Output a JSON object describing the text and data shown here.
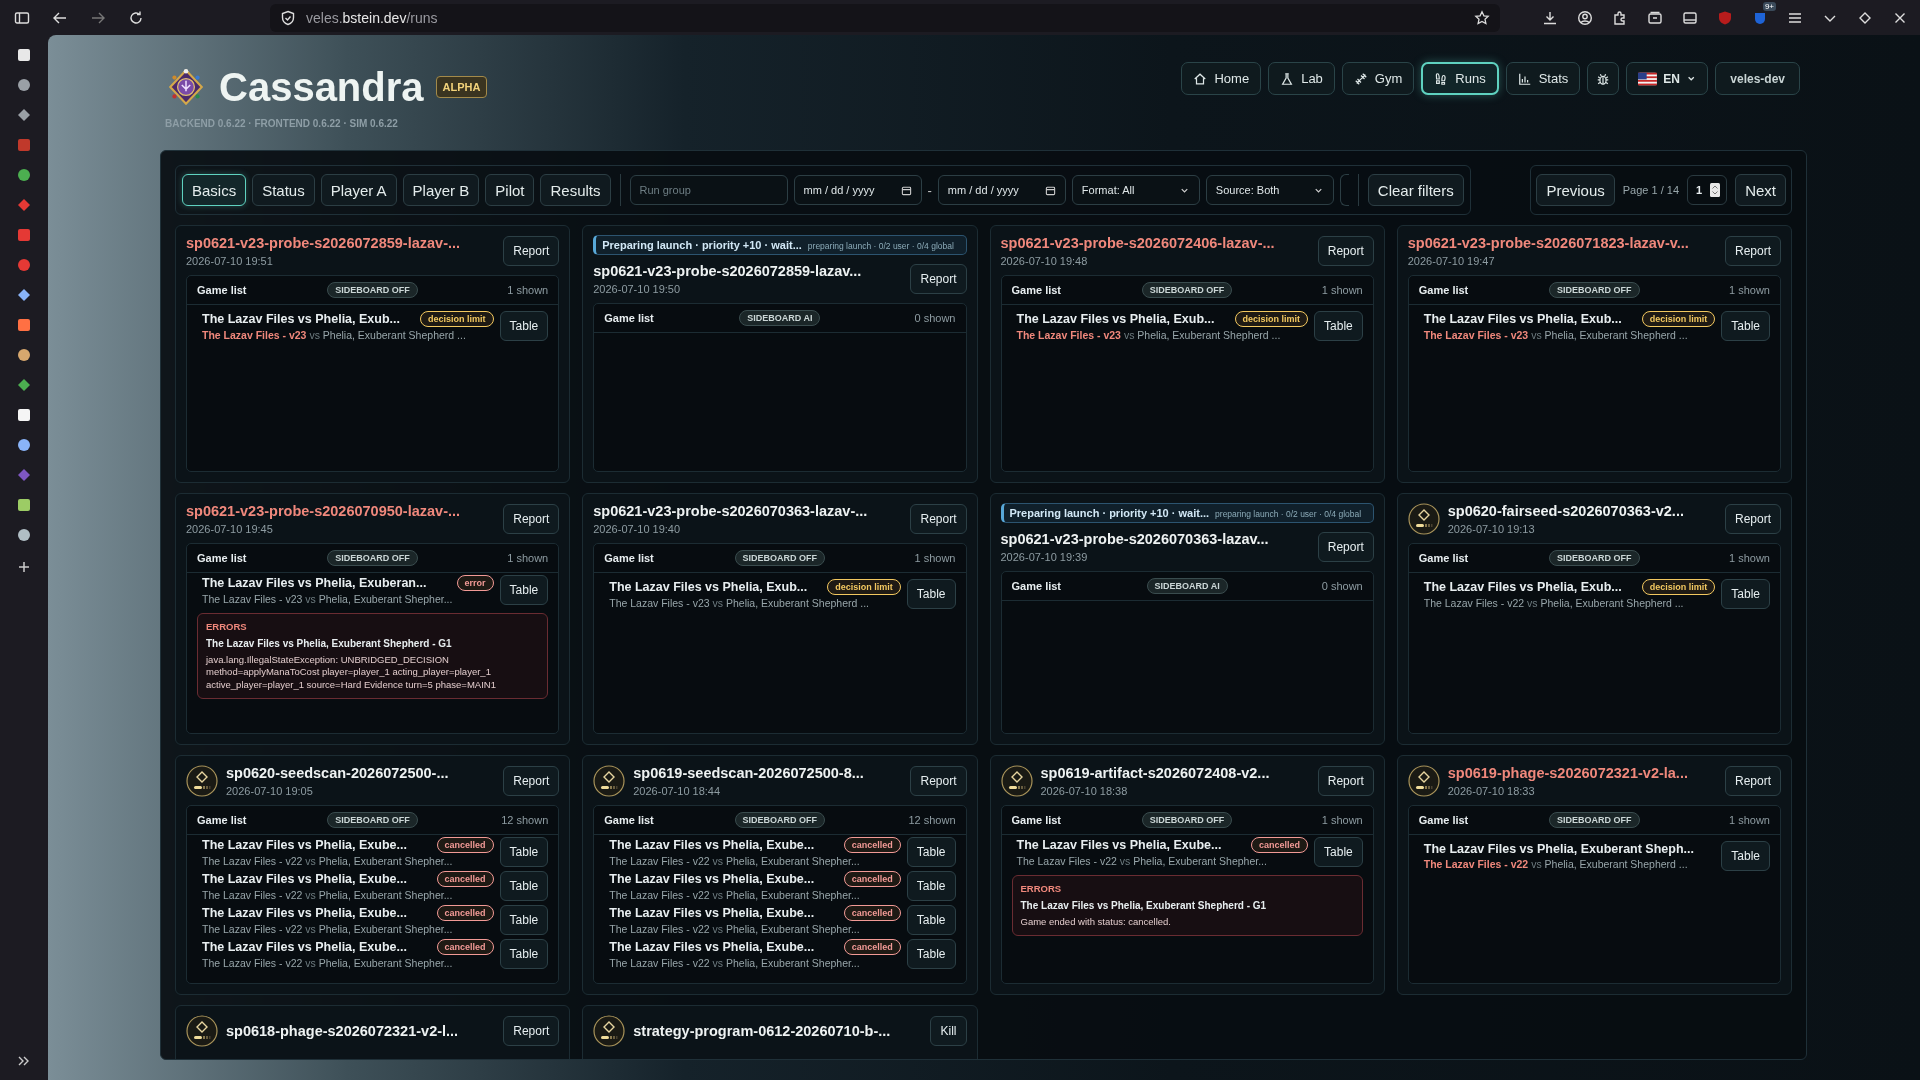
{
  "browser": {
    "url": {
      "subdomain": "veles.",
      "domain": "bstein.dev",
      "path": "/runs"
    },
    "extension_badge": "9+"
  },
  "header": {
    "title": "Cassandra",
    "badge": "ALPHA",
    "versions": "BACKEND 0.6.22 · FRONTEND 0.6.22 · SIM 0.6.22"
  },
  "nav": {
    "items": [
      {
        "label": "Home",
        "selected": false
      },
      {
        "label": "Lab",
        "selected": false
      },
      {
        "label": "Gym",
        "selected": false
      },
      {
        "label": "Runs",
        "selected": true
      },
      {
        "label": "Stats",
        "selected": false
      }
    ],
    "language": "EN",
    "user": "veles-dev"
  },
  "filters": {
    "tabs": [
      {
        "label": "Basics",
        "selected": true
      },
      {
        "label": "Status",
        "selected": false
      },
      {
        "label": "Player A",
        "selected": false
      },
      {
        "label": "Player B",
        "selected": false
      },
      {
        "label": "Pilot",
        "selected": false
      },
      {
        "label": "Results",
        "selected": false
      }
    ],
    "run_group": {
      "placeholder": "Run group"
    },
    "date_from": {
      "placeholder": "mm / dd / yyyy"
    },
    "date_separator": "-",
    "date_to": {
      "placeholder": "mm / dd / yyyy"
    },
    "format": "Format: All",
    "source": "Source: Both",
    "clear": "Clear filters"
  },
  "pagination": {
    "previous": "Previous",
    "page": "Page 1 / 14",
    "page_input": "1",
    "next": "Next"
  },
  "cards": [
    {
      "title": "sp0621-v23-probe-s2026072859-lazav-...",
      "highlight": true,
      "avatar": false,
      "date": "2026-07-10 19:51",
      "action": "Report",
      "list": {
        "label": "Game list",
        "sideboard": "SIDEBOARD OFF",
        "shown": "1 shown",
        "games": [
          {
            "title": "The Lazav Files vs Phelia, Exub...",
            "status": "decision limit",
            "color": "#f2c860",
            "player_a": "The Lazav Files - v23",
            "player_a_highlight": true,
            "versus": "vs",
            "player_b": "Phelia, Exuberant Shepherd ...",
            "action": "Table"
          }
        ]
      }
    },
    {
      "banner": {
        "text": "Preparing launch · priority +10 · wait...",
        "detail": "preparing launch · 0/2 user · 0/4 global"
      },
      "title": "sp0621-v23-probe-s2026072859-lazav...",
      "highlight": false,
      "avatar": false,
      "date": "2026-07-10 19:50",
      "action": "Report",
      "list": {
        "label": "Game list",
        "sideboard": "SIDEBOARD AI",
        "shown": "0 shown"
      }
    },
    {
      "title": "sp0621-v23-probe-s2026072406-lazav-...",
      "highlight": true,
      "avatar": false,
      "date": "2026-07-10 19:48",
      "action": "Report",
      "list": {
        "label": "Game list",
        "sideboard": "SIDEBOARD OFF",
        "shown": "1 shown",
        "games": [
          {
            "title": "The Lazav Files vs Phelia, Exub...",
            "status": "decision limit",
            "color": "#f2c860",
            "player_a": "The Lazav Files - v23",
            "player_a_highlight": true,
            "versus": "vs",
            "player_b": "Phelia, Exuberant Shepherd ...",
            "action": "Table"
          }
        ]
      }
    },
    {
      "title": "sp0621-v23-probe-s2026071823-lazav-v...",
      "highlight": true,
      "avatar": false,
      "date": "2026-07-10 19:47",
      "action": "Report",
      "list": {
        "label": "Game list",
        "sideboard": "SIDEBOARD OFF",
        "shown": "1 shown",
        "games": [
          {
            "title": "The Lazav Files vs Phelia, Exub...",
            "status": "decision limit",
            "color": "#f2c860",
            "player_a": "The Lazav Files - v23",
            "player_a_highlight": true,
            "versus": "vs",
            "player_b": "Phelia, Exuberant Shepherd ...",
            "action": "Table"
          }
        ]
      }
    },
    {
      "title": "sp0621-v23-probe-s2026070950-lazav-...",
      "highlight": true,
      "avatar": false,
      "date": "2026-07-10 19:45",
      "action": "Report",
      "list": {
        "label": "Game list",
        "sideboard": "SIDEBOARD OFF",
        "shown": "1 shown",
        "games": [
          {
            "title": "The Lazav Files vs Phelia, Exuberan...",
            "status": "error",
            "color": "#f29a96",
            "player_a": "The Lazav Files - v23",
            "player_a_highlight": false,
            "versus": "vs",
            "player_b": "Phelia, Exuberant Shepher...",
            "action": "Table"
          }
        ],
        "errors": {
          "heading": "ERRORS",
          "game": "The Lazav Files vs Phelia, Exuberant Shepherd - G1",
          "lines": [
            "java.lang.IllegalStateException: UNBRIDGED_DECISION",
            "method=applyManaToCost player=player_1 acting_player=player_1",
            "active_player=player_1 source=Hard Evidence turn=5 phase=MAIN1"
          ]
        }
      }
    },
    {
      "title": "sp0621-v23-probe-s2026070363-lazav-...",
      "highlight": false,
      "avatar": false,
      "date": "2026-07-10 19:40",
      "action": "Report",
      "list": {
        "label": "Game list",
        "sideboard": "SIDEBOARD OFF",
        "shown": "1 shown",
        "games": [
          {
            "title": "The Lazav Files vs Phelia, Exub...",
            "status": "decision limit",
            "color": "#f2c860",
            "player_a": "The Lazav Files - v23",
            "player_a_highlight": false,
            "versus": "vs",
            "player_b": "Phelia, Exuberant Shepherd ...",
            "action": "Table"
          }
        ]
      }
    },
    {
      "banner": {
        "text": "Preparing launch · priority +10 · wait...",
        "detail": "preparing launch · 0/2 user · 0/4 global"
      },
      "title": "sp0621-v23-probe-s2026070363-lazav...",
      "highlight": false,
      "avatar": false,
      "date": "2026-07-10 19:39",
      "action": "Report",
      "list": {
        "label": "Game list",
        "sideboard": "SIDEBOARD AI",
        "shown": "0 shown"
      }
    },
    {
      "title": "sp0620-fairseed-s2026070363-v2...",
      "highlight": false,
      "avatar": true,
      "date": "2026-07-10 19:13",
      "action": "Report",
      "list": {
        "label": "Game list",
        "sideboard": "SIDEBOARD OFF",
        "shown": "1 shown",
        "games": [
          {
            "title": "The Lazav Files vs Phelia, Exub...",
            "status": "decision limit",
            "color": "#f2c860",
            "player_a": "The Lazav Files - v22",
            "player_a_highlight": false,
            "versus": "vs",
            "player_b": "Phelia, Exuberant Shepherd ...",
            "action": "Table"
          }
        ]
      }
    },
    {
      "title": "sp0620-seedscan-2026072500-...",
      "highlight": false,
      "avatar": true,
      "date": "2026-07-10 19:05",
      "action": "Report",
      "list": {
        "label": "Game list",
        "sideboard": "SIDEBOARD OFF",
        "shown": "12 shown",
        "games": [
          {
            "title": "The Lazav Files vs Phelia, Exube...",
            "status": "cancelled",
            "color": "#f29a96",
            "player_a": "The Lazav Files - v22",
            "player_a_highlight": false,
            "versus": "vs",
            "player_b": "Phelia, Exuberant Shepher...",
            "action": "Table"
          },
          {
            "title": "The Lazav Files vs Phelia, Exube...",
            "status": "cancelled",
            "color": "#f29a96",
            "player_a": "The Lazav Files - v22",
            "player_a_highlight": false,
            "versus": "vs",
            "player_b": "Phelia, Exuberant Shepher...",
            "action": "Table"
          },
          {
            "title": "The Lazav Files vs Phelia, Exube...",
            "status": "cancelled",
            "color": "#f29a96",
            "player_a": "The Lazav Files - v22",
            "player_a_highlight": false,
            "versus": "vs",
            "player_b": "Phelia, Exuberant Shepher...",
            "action": "Table"
          },
          {
            "title": "The Lazav Files vs Phelia, Exube...",
            "status": "cancelled",
            "color": "#f29a96",
            "player_a": "The Lazav Files - v22",
            "player_a_highlight": false,
            "versus": "vs",
            "player_b": "Phelia, Exuberant Shepher...",
            "action": "Table"
          }
        ]
      }
    },
    {
      "title": "sp0619-seedscan-2026072500-8...",
      "highlight": false,
      "avatar": true,
      "date": "2026-07-10 18:44",
      "action": "Report",
      "list": {
        "label": "Game list",
        "sideboard": "SIDEBOARD OFF",
        "shown": "12 shown",
        "games": [
          {
            "title": "The Lazav Files vs Phelia, Exube...",
            "status": "cancelled",
            "color": "#f29a96",
            "player_a": "The Lazav Files - v22",
            "player_a_highlight": false,
            "versus": "vs",
            "player_b": "Phelia, Exuberant Shepher...",
            "action": "Table"
          },
          {
            "title": "The Lazav Files vs Phelia, Exube...",
            "status": "cancelled",
            "color": "#f29a96",
            "player_a": "The Lazav Files - v22",
            "player_a_highlight": false,
            "versus": "vs",
            "player_b": "Phelia, Exuberant Shepher...",
            "action": "Table"
          },
          {
            "title": "The Lazav Files vs Phelia, Exube...",
            "status": "cancelled",
            "color": "#f29a96",
            "player_a": "The Lazav Files - v22",
            "player_a_highlight": false,
            "versus": "vs",
            "player_b": "Phelia, Exuberant Shepher...",
            "action": "Table"
          },
          {
            "title": "The Lazav Files vs Phelia, Exube...",
            "status": "cancelled",
            "color": "#f29a96",
            "player_a": "The Lazav Files - v22",
            "player_a_highlight": false,
            "versus": "vs",
            "player_b": "Phelia, Exuberant Shepher...",
            "action": "Table"
          }
        ]
      }
    },
    {
      "title": "sp0619-artifact-s2026072408-v2...",
      "highlight": false,
      "avatar": true,
      "date": "2026-07-10 18:38",
      "action": "Report",
      "list": {
        "label": "Game list",
        "sideboard": "SIDEBOARD OFF",
        "shown": "1 shown",
        "games": [
          {
            "title": "The Lazav Files vs Phelia, Exube...",
            "status": "cancelled",
            "color": "#f29a96",
            "player_a": "The Lazav Files - v22",
            "player_a_highlight": false,
            "versus": "vs",
            "player_b": "Phelia, Exuberant Shepher...",
            "action": "Table"
          }
        ],
        "errors": {
          "heading": "ERRORS",
          "game": "The Lazav Files vs Phelia, Exuberant Shepherd - G1",
          "lines": [
            "Game ended with status: cancelled."
          ]
        }
      }
    },
    {
      "title": "sp0619-phage-s2026072321-v2-la...",
      "highlight": true,
      "avatar": true,
      "date": "2026-07-10 18:33",
      "action": "Report",
      "list": {
        "label": "Game list",
        "sideboard": "SIDEBOARD OFF",
        "shown": "1 shown",
        "games": [
          {
            "title": "The Lazav Files vs Phelia, Exuberant Sheph...",
            "player_a": "The Lazav Files - v22",
            "player_a_highlight": true,
            "versus": "vs",
            "player_b": "Phelia, Exuberant Shepherd ...",
            "action": "Table"
          }
        ]
      }
    },
    {
      "title": "sp0618-phage-s2026072321-v2-l...",
      "highlight": false,
      "avatar": true,
      "action": "Report"
    },
    {
      "title": "strategy-program-0612-20260710-b-...",
      "highlight": false,
      "avatar": true,
      "action": "Kill"
    }
  ]
}
